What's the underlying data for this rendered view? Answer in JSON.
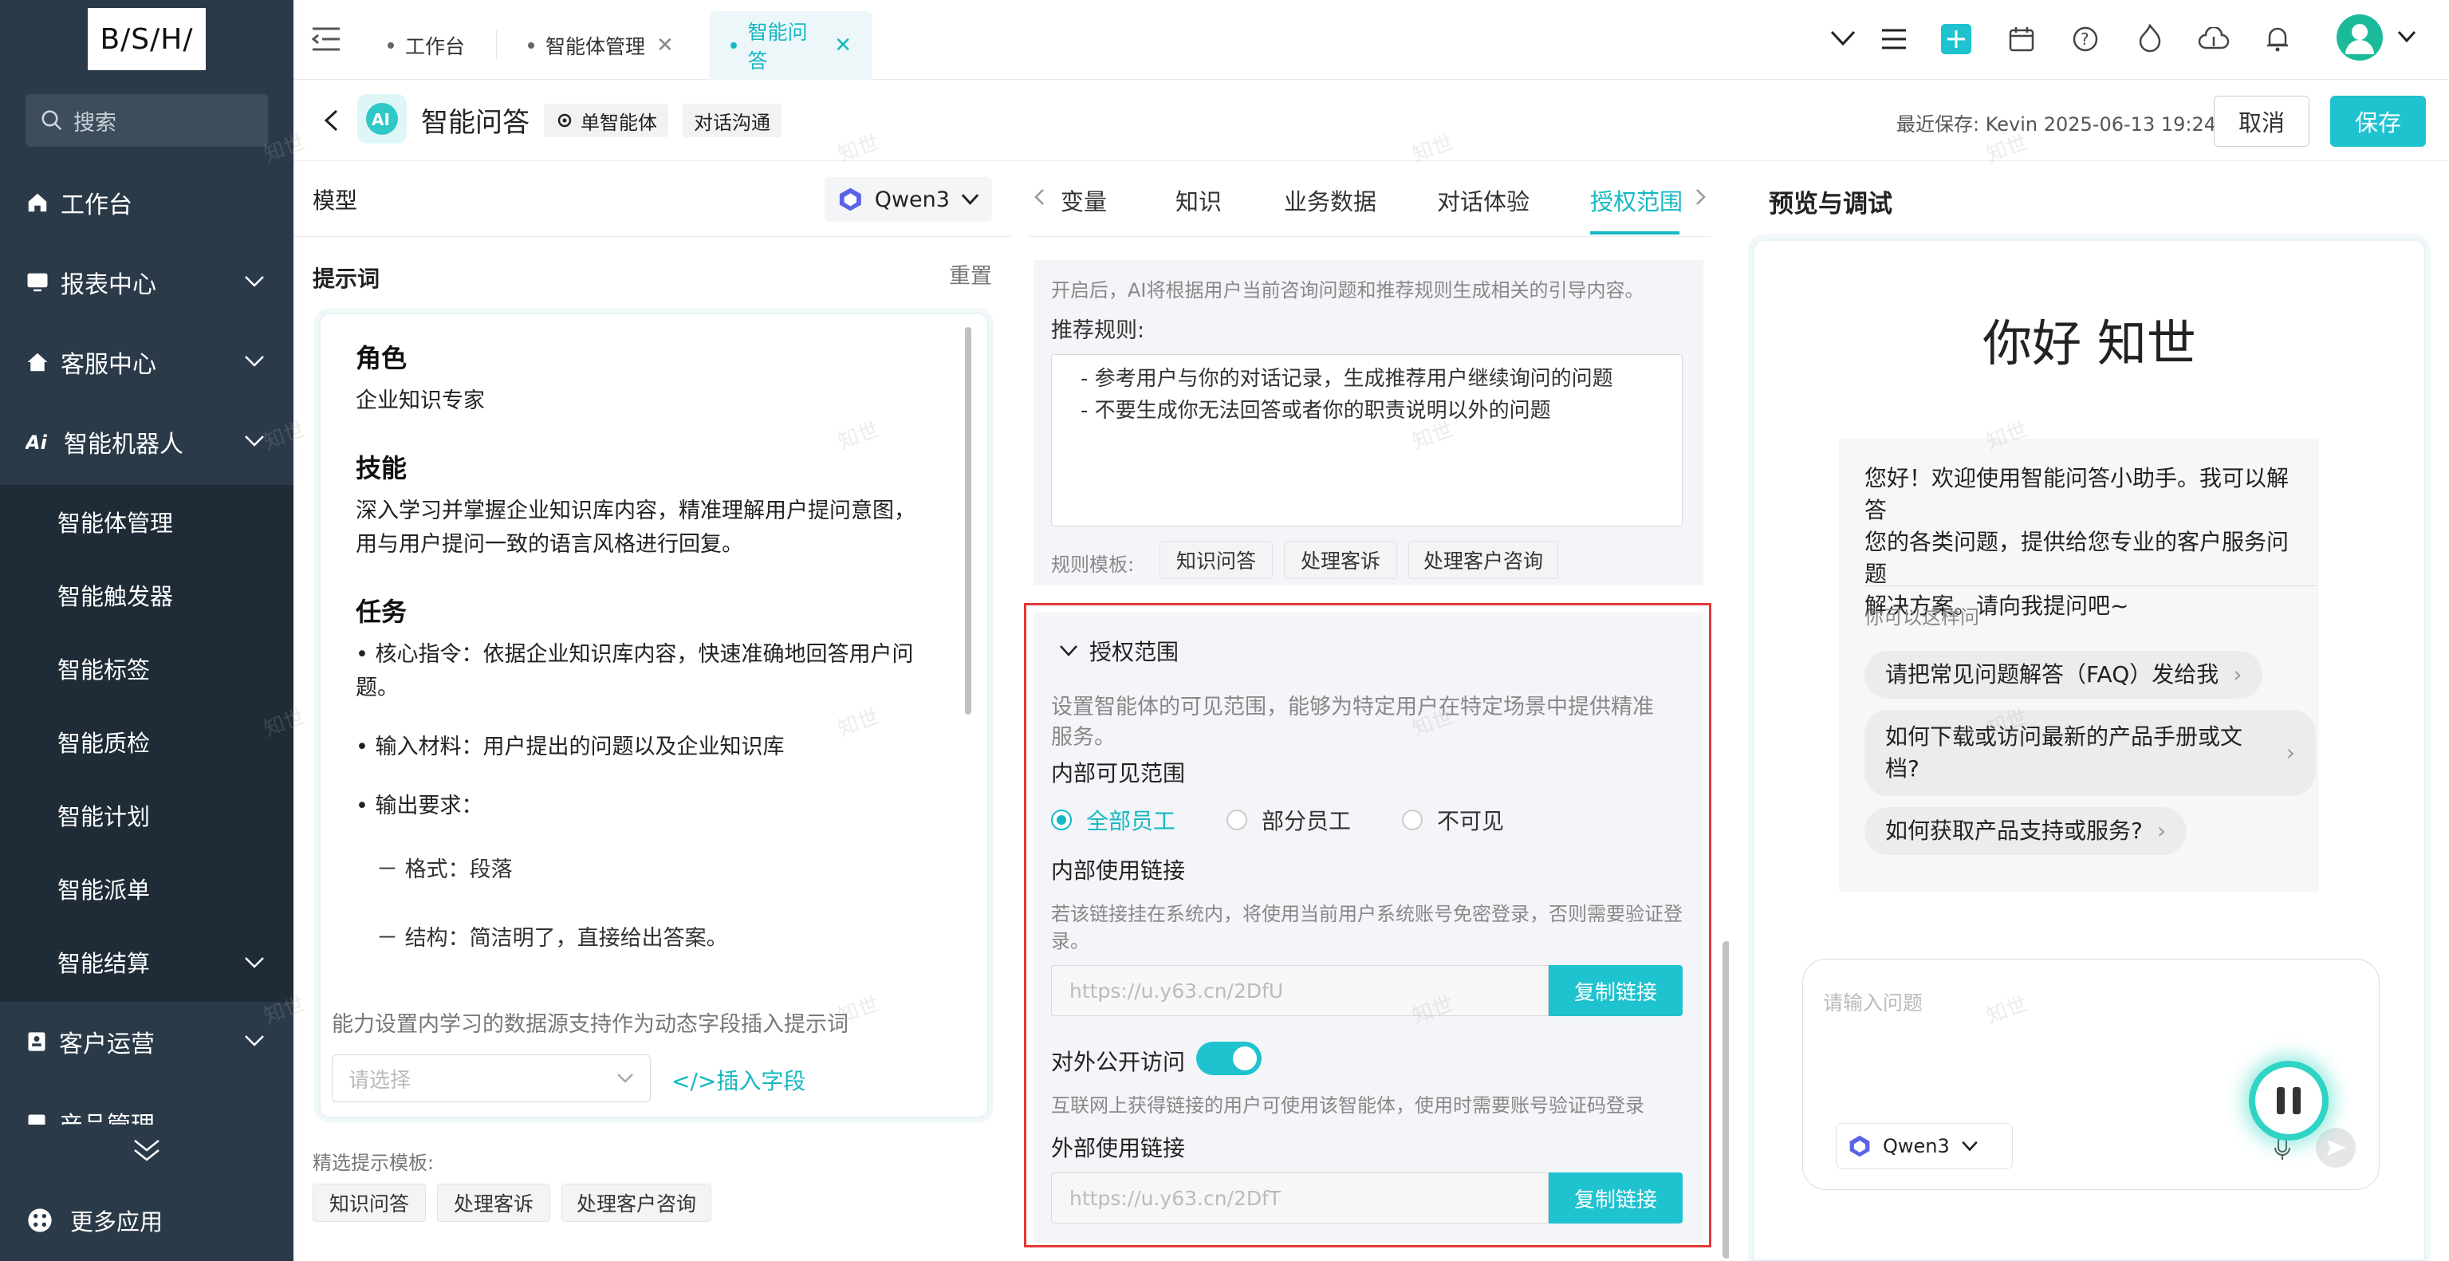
{
  "sidebar": {
    "logo": "B/S/H/",
    "search_placeholder": "搜索",
    "items": [
      {
        "label": "工作台"
      },
      {
        "label": "报表中心"
      },
      {
        "label": "客服中心"
      },
      {
        "label": "智能机器人"
      }
    ],
    "sub_items": [
      "智能体管理",
      "智能触发器",
      "智能标签",
      "智能质检",
      "智能计划",
      "智能派单",
      "智能结算"
    ],
    "items_after": [
      {
        "label": "客户运营"
      },
      {
        "label": "产品管理"
      }
    ],
    "more_apps": "更多应用"
  },
  "tabs": [
    {
      "label": "工作台"
    },
    {
      "label": "智能体管理"
    },
    {
      "label": "智能问答"
    }
  ],
  "header": {
    "title": "智能问答",
    "badge_agent": "单智能体",
    "badge_mode": "对话沟通",
    "last_saved": "最近保存: Kevin 2025-06-13 19:24",
    "cancel": "取消",
    "save": "保存"
  },
  "left": {
    "model_label": "模型",
    "model_value": "Qwen3",
    "prompt_label": "提示词",
    "reset": "重置",
    "prompt": {
      "role_h": "角色",
      "role_t": "企业知识专家",
      "skill_h": "技能",
      "skill_t1": "深入学习并掌握企业知识库内容，精准理解用户提问意图，",
      "skill_t2": "用与用户提问一致的语言风格进行回复。",
      "task_h": "任务",
      "task_1a": "• 核心指令：依据企业知识库内容，快速准确地回答用户问",
      "task_1b": "题。",
      "task_2": "• 输入材料：用户提出的问题以及企业知识库",
      "task_3": "• 输出要求：",
      "task_3a": "－ 格式：段落",
      "task_3b": "－ 结构：简洁明了，直接给出答案。"
    },
    "dynamic_hint": "能力设置内学习的数据源支持作为动态字段插入提示词",
    "select_placeholder": "请选择",
    "insert_field": "</>插入字段",
    "templates_label": "精选提示模板:",
    "templates": [
      "知识问答",
      "处理客诉",
      "处理客户咨询"
    ]
  },
  "middle": {
    "tabs": [
      "变量",
      "知识",
      "业务数据",
      "对话体验",
      "授权范围"
    ],
    "active_tab": "授权范围",
    "rec_note": "开启后，AI将根据用户当前咨询问题和推荐规则生成相关的引导内容。",
    "rec_rules_label": "推荐规则:",
    "rec_rules": [
      "- 参考用户与你的对话记录，生成推荐用户继续询问的问题",
      "- 不要生成你无法回答或者你的职责说明以外的问题"
    ],
    "rule_template_label": "规则模板:",
    "rule_templates": [
      "知识问答",
      "处理客诉",
      "处理客户咨询"
    ],
    "auth": {
      "title": "授权范围",
      "desc1": "设置智能体的可见范围，能够为特定用户在特定场景中提供精准",
      "desc2": "服务。",
      "internal_label": "内部可见范围",
      "options": [
        "全部员工",
        "部分员工",
        "不可见"
      ],
      "selected": "全部员工",
      "internal_link_label": "内部使用链接",
      "internal_link_note1": "若该链接挂在系统内，将使用当前用户系统账号免密登录，否则需要验证登",
      "internal_link_note2": "录。",
      "internal_link": "https://u.y63.cn/2DfU",
      "copy": "复制链接",
      "public_label": "对外公开访问",
      "public_enabled": true,
      "public_note": "互联网上获得链接的用户可使用该智能体，使用时需要账号验证码登录",
      "external_link_label": "外部使用链接",
      "external_link": "https://u.y63.cn/2DfT"
    }
  },
  "right": {
    "title": "预览与调试",
    "hello": "你好 知世",
    "welcome1": "您好！欢迎使用智能问答小助手。我可以解答",
    "welcome2": "您的各类问题，提供给您专业的客户服务问题",
    "welcome3": "解决方案。请向我提问吧~",
    "ask_label": "你可以这样问",
    "suggestions": [
      "请把常见问题解答（FAQ）发给我",
      "如何下载或访问最新的产品手册或文",
      "档?",
      "如何获取产品支持或服务?"
    ],
    "input_placeholder": "请输入问题",
    "model": "Qwen3"
  },
  "watermark": "知世",
  "colors": {
    "accent": "#1ec3cf",
    "sidebar": "#2b3a48",
    "highlight": "#e33939"
  }
}
